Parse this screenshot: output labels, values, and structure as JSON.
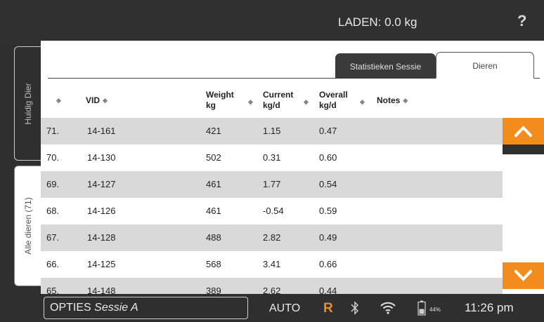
{
  "header": {
    "load_label": "LADEN: 0.0 kg",
    "help": "?"
  },
  "side_tabs": {
    "current_animal": "Huidig Dier",
    "all_animals": "Alle dieren (71)"
  },
  "top_tabs": {
    "stats": "Statistieken Sessie",
    "animals": "Dieren",
    "active": "Dieren"
  },
  "table": {
    "columns": [
      {
        "line1": "",
        "line2": ""
      },
      {
        "line1": "VID",
        "line2": ""
      },
      {
        "line1": "Weight",
        "line2": "kg"
      },
      {
        "line1": "Current",
        "line2": "kg/d"
      },
      {
        "line1": "Overall",
        "line2": "kg/d"
      },
      {
        "line1": "Notes",
        "line2": ""
      }
    ],
    "rows": [
      {
        "idx": "71.",
        "vid": "14-161",
        "weight": "421",
        "current": "1.15",
        "overall": "0.47",
        "notes": ""
      },
      {
        "idx": "70.",
        "vid": "14-130",
        "weight": "502",
        "current": "0.31",
        "overall": "0.60",
        "notes": ""
      },
      {
        "idx": "69.",
        "vid": "14-127",
        "weight": "461",
        "current": "1.77",
        "overall": "0.54",
        "notes": ""
      },
      {
        "idx": "68.",
        "vid": "14-126",
        "weight": "461",
        "current": "-0.54",
        "overall": "0.59",
        "notes": ""
      },
      {
        "idx": "67.",
        "vid": "14-128",
        "weight": "488",
        "current": "2.82",
        "overall": "0.49",
        "notes": ""
      },
      {
        "idx": "66.",
        "vid": "14-125",
        "weight": "568",
        "current": "3.41",
        "overall": "0.66",
        "notes": ""
      },
      {
        "idx": "65.",
        "vid": "14-148",
        "weight": "389",
        "current": "2.62",
        "overall": "0.44",
        "notes": ""
      }
    ]
  },
  "footer": {
    "options_label": "OPTIES",
    "session_name": "Sessie A",
    "mode": "AUTO",
    "remote_indicator": "R",
    "battery_percent": "44%",
    "time": "11:26 pm"
  },
  "icons": {
    "scroll_up": "chevron-up-icon",
    "scroll_down": "chevron-down-icon",
    "bluetooth": "bluetooth-icon",
    "wifi": "wifi-icon",
    "battery": "battery-icon"
  },
  "colors": {
    "accent": "#f28c1c",
    "frame": "#2f2f2f",
    "row_alt": "#d9d9d9"
  }
}
